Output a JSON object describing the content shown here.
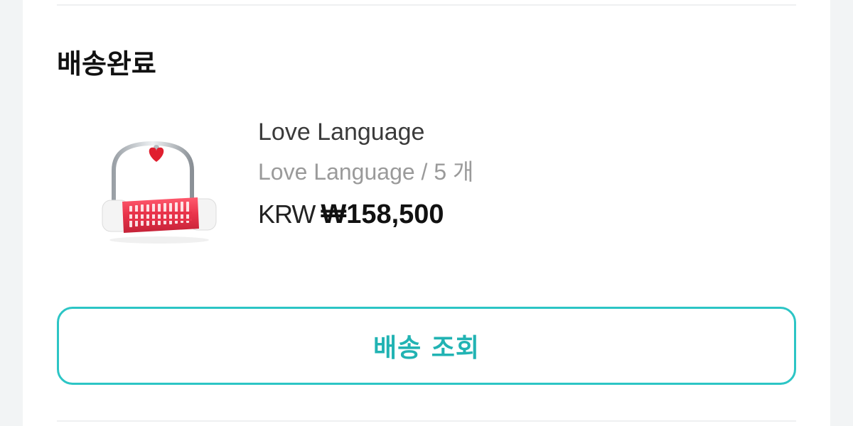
{
  "order": {
    "status_title": "배송완료"
  },
  "product": {
    "image_icon": "lock-product-image",
    "name": "Love Language",
    "option": "Love Language / 5 개",
    "price_currency": "KRW",
    "price_amount": "₩158,500"
  },
  "actions": {
    "track_label": "배송 조회"
  },
  "colors": {
    "accent": "#2cc5c5",
    "accent_text": "#21b3b3",
    "product_red": "#e8334a"
  }
}
